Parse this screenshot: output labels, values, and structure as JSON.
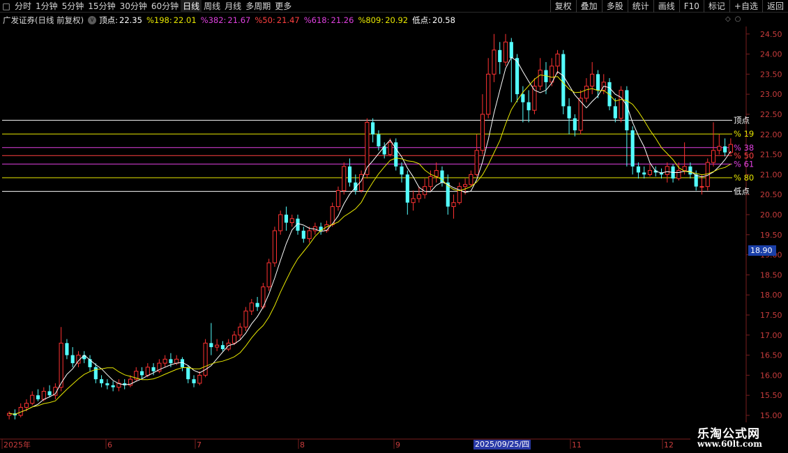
{
  "toolbar": {
    "items": [
      {
        "label": "分时",
        "active": false
      },
      {
        "label": "1分钟",
        "active": false
      },
      {
        "label": "5分钟",
        "active": false
      },
      {
        "label": "15分钟",
        "active": false
      },
      {
        "label": "30分钟",
        "active": false
      },
      {
        "label": "60分钟",
        "active": false
      },
      {
        "label": "日线",
        "active": true
      },
      {
        "label": "周线",
        "active": false
      },
      {
        "label": "月线",
        "active": false
      },
      {
        "label": "多周期",
        "active": false
      },
      {
        "label": "更多",
        "active": false
      }
    ],
    "right_items": [
      "复权",
      "叠加",
      "多股",
      "统计",
      "画线",
      "F10",
      "标记",
      "+自选",
      "返回"
    ]
  },
  "header": {
    "title": "广发证券(日线 前复权)",
    "top_label": "顶点:",
    "top_value": "22.35",
    "f198_label": "%198:",
    "f198_value": "22.01",
    "f382_label": "%382:",
    "f382_value": "21.67",
    "f50_label": "%50:",
    "f50_value": "21.47",
    "f618_label": "%618:",
    "f618_value": "21.26",
    "f809_label": "%809:",
    "f809_value": "20.92",
    "low_label": "低点:",
    "low_value": "20.58"
  },
  "chart_data": {
    "type": "candlestick",
    "y_range": [
      15.0,
      24.6
    ],
    "y_ticks": [
      "24.50",
      "24.00",
      "23.50",
      "23.00",
      "22.50",
      "22.00",
      "21.50",
      "21.00",
      "20.50",
      "20.00",
      "19.50",
      "19.00",
      "18.50",
      "18.00",
      "17.50",
      "17.00",
      "16.50",
      "16.00",
      "15.50",
      "15.00"
    ],
    "x_labels": [
      "2025年",
      "6",
      "7",
      "8",
      "9",
      "2025/09/25/四",
      "11",
      "12"
    ],
    "levels": [
      {
        "name": "顶点",
        "value": 22.35,
        "color": "#ffffff"
      },
      {
        "name": "%198",
        "value": 22.01,
        "color": "#e8e800"
      },
      {
        "name": "%382",
        "value": 21.67,
        "color": "#e040e0"
      },
      {
        "name": "%50",
        "value": 21.47,
        "color": "#ff4040"
      },
      {
        "name": "%618",
        "value": 21.26,
        "color": "#e040e0"
      },
      {
        "name": "%809",
        "value": 20.92,
        "color": "#e8e800"
      },
      {
        "name": "低点",
        "value": 20.58,
        "color": "#ffffff"
      }
    ],
    "level_labels": [
      "顶点",
      "% 19",
      "% 38",
      "% 50",
      "% 61",
      "% 80",
      "低点"
    ],
    "price_tag": "18.90",
    "candles": [
      [
        15.0,
        15.05,
        14.9,
        15.1
      ],
      [
        15.05,
        15.0,
        14.9,
        15.15
      ],
      [
        15.0,
        15.2,
        14.95,
        15.3
      ],
      [
        15.2,
        15.3,
        15.1,
        15.4
      ],
      [
        15.3,
        15.5,
        15.25,
        15.6
      ],
      [
        15.5,
        15.4,
        15.35,
        15.65
      ],
      [
        15.4,
        15.6,
        15.35,
        15.7
      ],
      [
        15.6,
        15.5,
        15.45,
        15.75
      ],
      [
        15.5,
        15.7,
        15.4,
        15.8
      ],
      [
        15.7,
        16.8,
        15.6,
        17.2
      ],
      [
        16.8,
        16.5,
        16.4,
        16.9
      ],
      [
        16.5,
        16.3,
        16.2,
        16.7
      ],
      [
        16.3,
        16.5,
        16.2,
        16.6
      ],
      [
        16.5,
        16.4,
        16.3,
        16.6
      ],
      [
        16.4,
        16.2,
        16.1,
        16.5
      ],
      [
        16.2,
        15.9,
        15.8,
        16.3
      ],
      [
        15.9,
        15.8,
        15.7,
        16.0
      ],
      [
        15.8,
        15.75,
        15.65,
        15.9
      ],
      [
        15.75,
        15.7,
        15.6,
        15.85
      ],
      [
        15.7,
        15.8,
        15.6,
        15.9
      ],
      [
        15.8,
        15.75,
        15.65,
        15.9
      ],
      [
        15.75,
        15.9,
        15.7,
        16.0
      ],
      [
        15.9,
        16.1,
        15.85,
        16.2
      ],
      [
        16.1,
        16.0,
        15.9,
        16.2
      ],
      [
        16.0,
        16.2,
        15.95,
        16.3
      ],
      [
        16.2,
        16.1,
        16.0,
        16.3
      ],
      [
        16.1,
        16.3,
        16.05,
        16.4
      ],
      [
        16.3,
        16.4,
        16.2,
        16.5
      ],
      [
        16.4,
        16.3,
        16.2,
        16.55
      ],
      [
        16.3,
        16.4,
        16.25,
        16.5
      ],
      [
        16.4,
        16.2,
        16.1,
        16.45
      ],
      [
        16.2,
        15.9,
        15.8,
        16.25
      ],
      [
        15.9,
        15.8,
        15.7,
        16.0
      ],
      [
        15.8,
        16.0,
        15.75,
        16.1
      ],
      [
        16.0,
        16.8,
        15.95,
        16.9
      ],
      [
        16.8,
        16.7,
        16.5,
        17.3
      ],
      [
        16.7,
        16.75,
        16.6,
        16.9
      ],
      [
        16.75,
        16.65,
        16.6,
        16.85
      ],
      [
        16.65,
        16.8,
        16.6,
        16.9
      ],
      [
        16.8,
        17.0,
        16.75,
        17.1
      ],
      [
        17.0,
        17.2,
        16.9,
        17.3
      ],
      [
        17.2,
        17.6,
        17.1,
        17.7
      ],
      [
        17.6,
        17.8,
        17.5,
        17.9
      ],
      [
        17.8,
        17.7,
        17.6,
        17.95
      ],
      [
        17.7,
        18.2,
        17.65,
        18.3
      ],
      [
        18.2,
        18.8,
        18.1,
        18.9
      ],
      [
        18.8,
        19.6,
        18.7,
        19.7
      ],
      [
        19.6,
        20.0,
        19.5,
        20.1
      ],
      [
        20.0,
        19.8,
        19.6,
        20.2
      ],
      [
        19.8,
        19.9,
        19.7,
        20.0
      ],
      [
        19.9,
        19.6,
        19.5,
        20.0
      ],
      [
        19.6,
        19.4,
        19.3,
        19.7
      ],
      [
        19.4,
        19.6,
        19.3,
        19.7
      ],
      [
        19.6,
        19.7,
        19.5,
        19.8
      ],
      [
        19.7,
        19.6,
        19.5,
        19.8
      ],
      [
        19.6,
        19.75,
        19.55,
        19.85
      ],
      [
        19.75,
        20.2,
        19.7,
        20.3
      ],
      [
        20.2,
        20.6,
        20.1,
        20.7
      ],
      [
        20.6,
        21.2,
        20.5,
        21.3
      ],
      [
        21.2,
        20.8,
        20.7,
        21.4
      ],
      [
        20.8,
        20.6,
        20.5,
        21.0
      ],
      [
        20.6,
        21.0,
        20.55,
        21.1
      ],
      [
        21.0,
        22.3,
        20.9,
        22.4
      ],
      [
        22.3,
        22.0,
        21.8,
        22.4
      ],
      [
        22.0,
        21.7,
        21.6,
        22.1
      ],
      [
        21.7,
        21.5,
        21.4,
        21.8
      ],
      [
        21.5,
        21.8,
        21.45,
        21.9
      ],
      [
        21.8,
        21.2,
        21.1,
        21.9
      ],
      [
        21.2,
        21.0,
        20.8,
        21.3
      ],
      [
        21.0,
        20.3,
        20.0,
        21.1
      ],
      [
        20.3,
        20.4,
        20.1,
        20.6
      ],
      [
        20.4,
        20.5,
        20.3,
        20.7
      ],
      [
        20.5,
        20.7,
        20.4,
        20.9
      ],
      [
        20.7,
        20.95,
        20.6,
        21.1
      ],
      [
        20.95,
        21.1,
        20.8,
        21.3
      ],
      [
        21.1,
        20.8,
        20.7,
        21.2
      ],
      [
        20.8,
        20.2,
        20.0,
        21.0
      ],
      [
        20.2,
        20.3,
        19.9,
        20.5
      ],
      [
        20.3,
        20.7,
        20.25,
        20.8
      ],
      [
        20.7,
        20.75,
        20.5,
        20.9
      ],
      [
        20.75,
        21.0,
        20.7,
        21.1
      ],
      [
        21.0,
        21.6,
        20.95,
        22.0
      ],
      [
        21.6,
        22.5,
        21.5,
        23.0
      ],
      [
        22.5,
        23.5,
        22.4,
        23.9
      ],
      [
        23.5,
        24.1,
        23.3,
        24.5
      ],
      [
        24.1,
        23.8,
        23.5,
        24.3
      ],
      [
        23.8,
        24.3,
        23.7,
        24.5
      ],
      [
        24.3,
        23.9,
        22.8,
        24.4
      ],
      [
        23.9,
        23.0,
        22.8,
        24.0
      ],
      [
        23.0,
        22.8,
        22.3,
        23.2
      ],
      [
        22.8,
        22.6,
        22.3,
        23.1
      ],
      [
        22.6,
        23.2,
        22.5,
        23.4
      ],
      [
        23.2,
        23.6,
        23.1,
        23.9
      ],
      [
        23.6,
        23.3,
        23.0,
        23.8
      ],
      [
        23.3,
        23.7,
        23.2,
        23.9
      ],
      [
        23.7,
        24.0,
        23.5,
        24.1
      ],
      [
        24.0,
        22.7,
        22.5,
        24.1
      ],
      [
        22.7,
        22.4,
        22.0,
        22.9
      ],
      [
        22.4,
        22.1,
        21.95,
        22.5
      ],
      [
        22.1,
        22.9,
        22.0,
        23.1
      ],
      [
        22.9,
        23.2,
        22.8,
        23.4
      ],
      [
        23.2,
        23.5,
        23.0,
        23.8
      ],
      [
        23.5,
        23.1,
        22.9,
        23.6
      ],
      [
        23.1,
        23.3,
        23.0,
        23.5
      ],
      [
        23.3,
        22.7,
        22.6,
        23.4
      ],
      [
        22.7,
        22.4,
        22.3,
        22.9
      ],
      [
        22.4,
        23.1,
        22.3,
        23.2
      ],
      [
        23.1,
        22.1,
        21.2,
        23.2
      ],
      [
        22.1,
        21.2,
        21.0,
        22.2
      ],
      [
        21.2,
        21.05,
        20.9,
        21.3
      ],
      [
        21.05,
        21.0,
        20.9,
        21.2
      ],
      [
        21.0,
        21.1,
        20.95,
        21.25
      ],
      [
        21.1,
        21.05,
        20.95,
        21.2
      ],
      [
        21.05,
        21.0,
        20.9,
        21.15
      ],
      [
        21.0,
        21.2,
        20.8,
        21.3
      ],
      [
        21.2,
        20.9,
        20.8,
        21.25
      ],
      [
        20.9,
        21.1,
        20.85,
        21.3
      ],
      [
        21.1,
        21.2,
        21.0,
        21.8
      ],
      [
        21.2,
        21.0,
        20.9,
        21.3
      ],
      [
        21.0,
        20.7,
        20.6,
        21.1
      ],
      [
        20.7,
        20.7,
        20.5,
        21.0
      ],
      [
        20.7,
        21.3,
        20.6,
        21.4
      ],
      [
        21.3,
        21.6,
        21.2,
        22.3
      ],
      [
        21.6,
        21.7,
        21.5,
        22.0
      ],
      [
        21.7,
        21.55,
        21.45,
        21.9
      ],
      [
        21.55,
        21.75,
        21.5,
        21.9
      ]
    ]
  },
  "watermark": {
    "title": "乐淘公式网",
    "url": "www.60lt.com"
  }
}
